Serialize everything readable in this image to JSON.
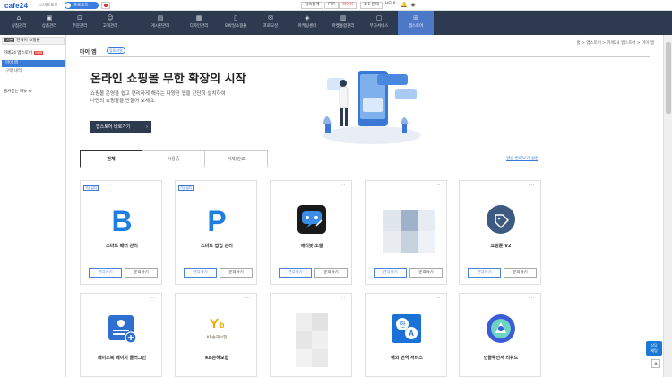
{
  "topbar": {
    "logo": "cafe24",
    "smartmode_label": "스마트모드",
    "toggle_label": "프로모드",
    "flag_label": "KR",
    "btn_stats": "접속통계",
    "btn_ftp": "FTP",
    "btn_live": "라이브",
    "btn_inquiry": "1:1 문의",
    "help": "HELP"
  },
  "nav": {
    "items": [
      {
        "label": "상점관리"
      },
      {
        "label": "상품관리"
      },
      {
        "label": "주문관리"
      },
      {
        "label": "고객관리"
      },
      {
        "label": "게시판관리"
      },
      {
        "label": "디자인관리"
      },
      {
        "label": "모바일쇼핑몰"
      },
      {
        "label": "프로모션"
      },
      {
        "label": "마케팅센터"
      },
      {
        "label": "마켓통합관리"
      },
      {
        "label": "부가서비스"
      },
      {
        "label": "앱스토어"
      }
    ]
  },
  "sidebar": {
    "head_badge": "기본",
    "head_label": "한국어 쇼핑몰",
    "section_title": "카페24 앱스토어",
    "section_new": "NEW",
    "items": [
      {
        "label": "마이 앱"
      },
      {
        "label": "구매 내역"
      }
    ],
    "favorites": "즐겨찾는 메뉴"
  },
  "main": {
    "title": "마이 앱",
    "tutorial": "튜토리얼",
    "breadcrumb": "홈 > 앱스토어 > 카페24 앱스토어 > 마이 앱",
    "hero_title": "온라인 쇼핑몰 무한 확장의 시작",
    "hero_desc_1": "쇼핑몰 운영을 쉽고 편리하게 해주는 다양한 앱을 간단히 설치하여",
    "hero_desc_2": "나만의 쇼핑몰을 만들어 보세요.",
    "hero_button": "앱스토어 바로가기",
    "tabs": [
      {
        "label": "전체"
      },
      {
        "label": "사용중"
      },
      {
        "label": "삭제/만료"
      }
    ],
    "tab_link": "알림 받아보기 설정"
  },
  "cards": [
    {
      "tag": "기본설치",
      "name": "스마트 배너 관리",
      "btn1": "관리하기",
      "btn2": "문의하기",
      "icon": "b-letter-icon",
      "color": "#1f7fe0"
    },
    {
      "tag": "기본설치",
      "name": "스마트 팝업 관리",
      "btn1": "관리하기",
      "btn2": "문의하기",
      "icon": "p-letter-icon",
      "color": "#1f7fe0"
    },
    {
      "tag": "",
      "name": "애티봇 소셜",
      "btn1": "관리하기",
      "btn2": "문의하기",
      "icon": "chatbot-icon",
      "color": "#1a1a1a"
    },
    {
      "tag": "",
      "name": "",
      "btn1": "관리하기",
      "btn2": "문의하기",
      "icon": "blurred-icon",
      "color": "#b5c4d6"
    },
    {
      "tag": "",
      "name": "쇼핑툰 V2",
      "btn1": "관리하기",
      "btn2": "문의하기",
      "icon": "price-tag-icon",
      "color": "#3d5a80"
    },
    {
      "tag": "",
      "name": "페이스북 페이지 플러그인",
      "icon": "profile-card-icon",
      "color": "#2f6fd0"
    },
    {
      "tag": "",
      "name": "KB손해보험",
      "icon": "kb-logo-icon",
      "color": "#f2a800"
    },
    {
      "tag": "",
      "name": "",
      "icon": "blurred-icon",
      "color": "#d9d9d9"
    },
    {
      "tag": "",
      "name": "해외 번역 서비스",
      "icon": "translate-icon",
      "color": "#1b72d6"
    },
    {
      "tag": "",
      "name": "인플루언서 리워드",
      "icon": "influencer-icon",
      "color": "#3b5bd9"
    }
  ],
  "kb_text": "KB손해보험",
  "float": {
    "label_1": "상담",
    "label_2": "채팅"
  }
}
